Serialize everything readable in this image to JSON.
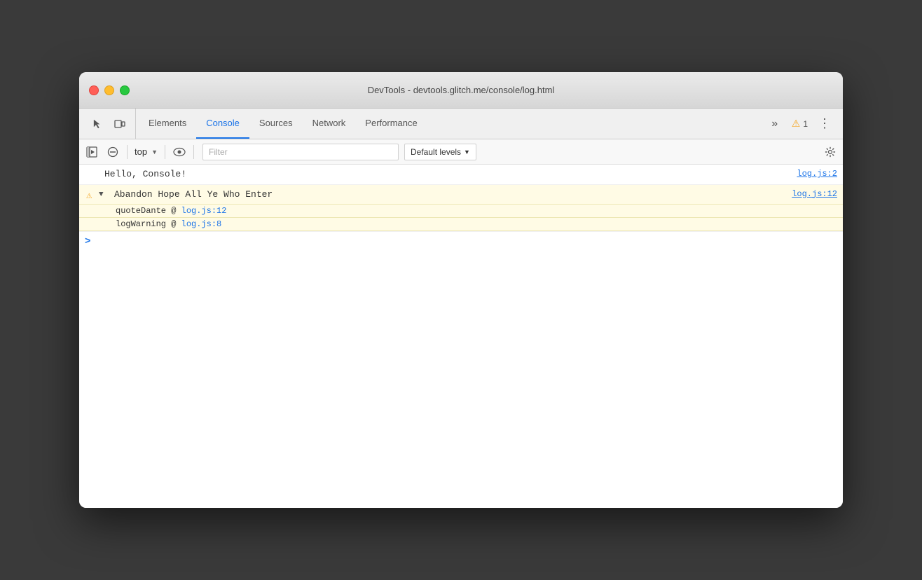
{
  "window": {
    "title": "DevTools - devtools.glitch.me/console/log.html"
  },
  "tabs": [
    {
      "id": "elements",
      "label": "Elements",
      "active": false
    },
    {
      "id": "console",
      "label": "Console",
      "active": true
    },
    {
      "id": "sources",
      "label": "Sources",
      "active": false
    },
    {
      "id": "network",
      "label": "Network",
      "active": false
    },
    {
      "id": "performance",
      "label": "Performance",
      "active": false
    }
  ],
  "more_tabs_label": "»",
  "warnings_count": "1",
  "more_options_label": "⋮",
  "console_toolbar": {
    "context": "top",
    "filter_placeholder": "Filter",
    "levels_label": "Default levels",
    "levels_arrow": "▼"
  },
  "log_entries": [
    {
      "type": "info",
      "text": "Hello, Console!",
      "location": "log.js:2"
    },
    {
      "type": "warning",
      "text": "Abandon Hope All Ye Who Enter",
      "location": "log.js:12",
      "expanded": true,
      "stack": [
        {
          "fn": "quoteDante",
          "link_text": "log.js:12",
          "link_href": "#"
        },
        {
          "fn": "logWarning",
          "link_text": "log.js:8",
          "link_href": "#"
        }
      ]
    }
  ],
  "prompt_symbol": ">"
}
